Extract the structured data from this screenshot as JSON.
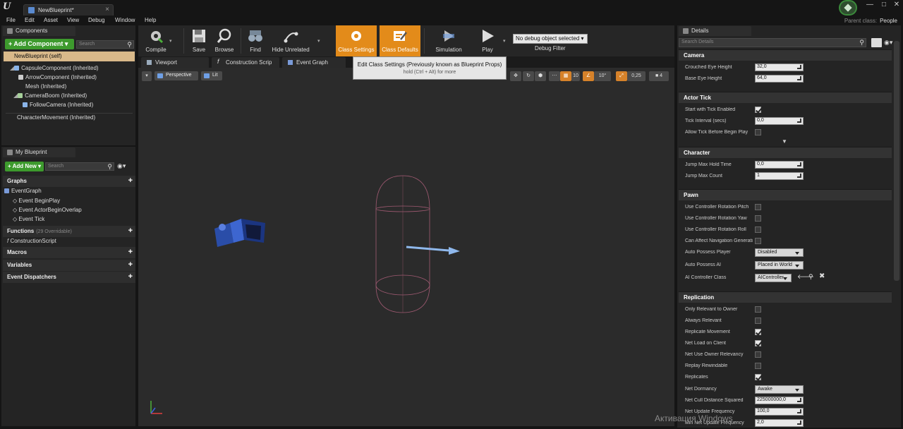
{
  "titlebar": {
    "doc_tab": "NewBlueprint*",
    "close_glyph": "×"
  },
  "window_controls": {
    "minimize": "—",
    "maximize": "□",
    "close": "✕"
  },
  "menu": [
    "File",
    "Edit",
    "Asset",
    "View",
    "Debug",
    "Window",
    "Help"
  ],
  "parent_class": {
    "label": "Parent class:",
    "value": "People"
  },
  "components": {
    "tab": "Components",
    "add_button": "+ Add Component ▾",
    "search_placeholder": "Search",
    "items": [
      "NewBlueprint (self)",
      "CapsuleComponent (Inherited)",
      "ArrowComponent (Inherited)",
      "Mesh (Inherited)",
      "CameraBoom (Inherited)",
      "FollowCamera (Inherited)",
      "CharacterMovement (Inherited)"
    ]
  },
  "my_blueprint": {
    "tab": "My Blueprint",
    "add_button": "+ Add New ▾",
    "search_placeholder": "Search",
    "graphs_header": "Graphs",
    "graph_items": [
      "EventGraph",
      "Event BeginPlay",
      "Event ActorBeginOverlap",
      "Event Tick"
    ],
    "functions_header": "Functions",
    "functions_sub": "(29 Overridable)",
    "function_items": [
      "ConstructionScript"
    ],
    "macros_header": "Macros",
    "variables_header": "Variables",
    "dispatchers_header": "Event Dispatchers"
  },
  "toolbar": {
    "compile": "Compile",
    "save": "Save",
    "browse": "Browse",
    "find": "Find",
    "hide_unrelated": "Hide Unrelated",
    "class_settings": "Class Settings",
    "class_defaults": "Class Defaults",
    "simulation": "Simulation",
    "play": "Play",
    "debug_dropdown": "No debug object selected ▾",
    "debug_filter": "Debug Filter"
  },
  "graph_tabs": [
    "Viewport",
    "Construction Scrip",
    "Event Graph"
  ],
  "viewport": {
    "perspective": "Perspective",
    "lit": "Lit",
    "grid_snap": "10",
    "rot_snap": "10°",
    "scale_snap": "0,25",
    "cam_speed": "4"
  },
  "tooltip": {
    "title": "Edit Class Settings (Previously known as Blueprint Props)",
    "hint": "hold (Ctrl + Alt) for more"
  },
  "details": {
    "tab": "Details",
    "search_placeholder": "Search Details",
    "camera": {
      "header": "Camera",
      "crouched_eye_height": {
        "label": "Crouched Eye Height",
        "value": "32,0"
      },
      "base_eye_height": {
        "label": "Base Eye Height",
        "value": "64,0"
      }
    },
    "actor_tick": {
      "header": "Actor Tick",
      "start_with_tick": {
        "label": "Start with Tick Enabled",
        "checked": true
      },
      "tick_interval": {
        "label": "Tick Interval (secs)",
        "value": "0,0"
      },
      "allow_tick_before_begin": {
        "label": "Allow Tick Before Begin Play",
        "checked": false
      }
    },
    "character": {
      "header": "Character",
      "jump_max_hold": {
        "label": "Jump Max Hold Time",
        "value": "0,0"
      },
      "jump_max_count": {
        "label": "Jump Max Count",
        "value": "1"
      }
    },
    "pawn": {
      "header": "Pawn",
      "ctrl_pitch": {
        "label": "Use Controller Rotation Pitch",
        "checked": false
      },
      "ctrl_yaw": {
        "label": "Use Controller Rotation Yaw",
        "checked": false
      },
      "ctrl_roll": {
        "label": "Use Controller Rotation Roll",
        "checked": false
      },
      "nav_gen": {
        "label": "Can Affect Navigation Generation",
        "checked": false
      },
      "auto_player": {
        "label": "Auto Possess Player",
        "value": "Disabled"
      },
      "auto_ai": {
        "label": "Auto Possess AI",
        "value": "Placed in World"
      },
      "ai_class": {
        "label": "AI Controller Class",
        "value": "AIController"
      }
    },
    "replication": {
      "header": "Replication",
      "only_relevant_owner": {
        "label": "Only Relevant to Owner",
        "checked": false
      },
      "always_relevant": {
        "label": "Always Relevant",
        "checked": false
      },
      "replicate_movement": {
        "label": "Replicate Movement",
        "checked": true
      },
      "net_load_client": {
        "label": "Net Load on Client",
        "checked": true
      },
      "net_use_owner": {
        "label": "Net Use Owner Relevancy",
        "checked": false
      },
      "replay_rewindable": {
        "label": "Replay Rewindable",
        "checked": false
      },
      "replicates": {
        "label": "Replicates",
        "checked": true
      },
      "net_dormancy": {
        "label": "Net Dormancy",
        "value": "Awake"
      },
      "net_cull": {
        "label": "Net Cull Distance Squared",
        "value": "225000000,0"
      },
      "net_update_freq": {
        "label": "Net Update Frequency",
        "value": "100,0"
      },
      "min_net_update_freq": {
        "label": "Min Net Update Frequency",
        "value": "2,0"
      }
    }
  },
  "watermark": "Активация Windows"
}
